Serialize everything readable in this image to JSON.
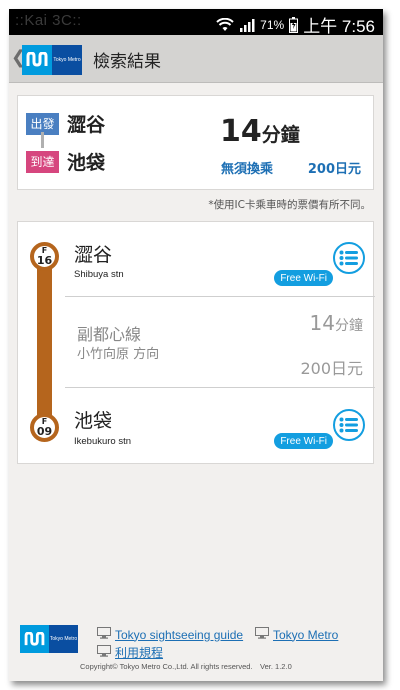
{
  "status_bar": {
    "carrier": "::Kai 3C::",
    "battery": "71%",
    "time": "上午 7:56"
  },
  "app_bar": {
    "back_icon": "chevron-left-icon",
    "logo_text": "Tokyo Metro",
    "title": "檢索結果"
  },
  "summary": {
    "departure_tag": "出發",
    "departure_station": "澀谷",
    "arrival_tag": "到達",
    "arrival_station": "池袋",
    "total_time_value": "14",
    "total_time_unit": "分鐘",
    "transfer": "無須換乘",
    "fare": "200日元"
  },
  "note": "*使用IC卡乘車時的票價有所不同。",
  "route": {
    "line_color": "#b5651d",
    "start": {
      "badge_letter": "F",
      "badge_number": "16",
      "name": "澀谷",
      "name_en": "Shibuya stn",
      "wifi": "Free Wi-Fi"
    },
    "segment": {
      "line_name": "副都心線",
      "direction": "小竹向原 方向",
      "time_value": "14",
      "time_unit": "分鐘",
      "fare": "200日元"
    },
    "end": {
      "badge_letter": "F",
      "badge_number": "09",
      "name": "池袋",
      "name_en": "Ikebukuro stn",
      "wifi": "Free Wi-Fi"
    }
  },
  "footer": {
    "logo_text": "Tokyo Metro",
    "link_sightseeing": "Tokyo sightseeing guide",
    "link_metro": "Tokyo Metro",
    "link_terms": "利用規程",
    "copyright": "Copyright© Tokyo Metro Co.,Ltd. All rights reserved.　Ver. 1.2.0"
  },
  "colors": {
    "accent_blue": "#139ee0",
    "departure_tag": "#4a7fc1",
    "arrival_tag": "#d6467e",
    "link_blue": "#1d6fb4"
  }
}
